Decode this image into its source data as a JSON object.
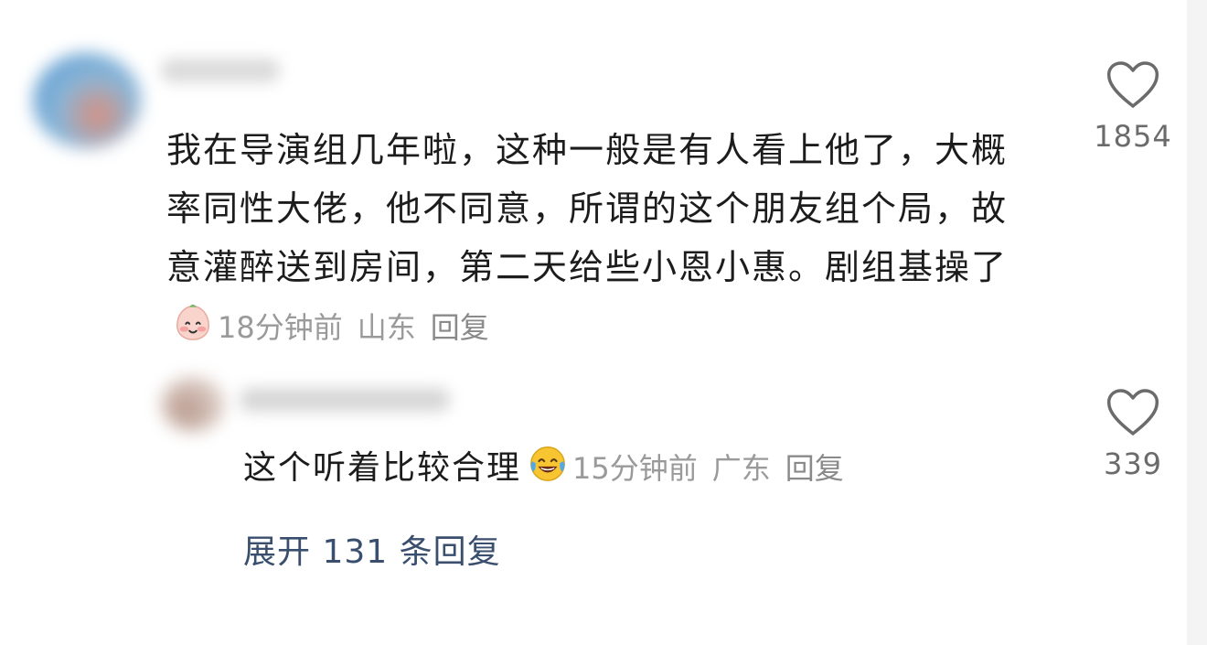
{
  "comment": {
    "text": "我在导演组几年啦，这种一般是有人看上他了，大概率同性大佬，他不同意，所谓的这个朋友组个局，故意灌醉送到房间，第二天给些小恩小惠。剧组基操了",
    "emoji": "blushing-face-emoji",
    "time": "18分钟前",
    "location": "山东",
    "reply_label": "回复",
    "likes": "1854"
  },
  "reply": {
    "text": "这个听着比较合理",
    "emoji": "laughing-tears-emoji",
    "time": "15分钟前",
    "location": "广东",
    "reply_label": "回复",
    "likes": "339"
  },
  "expand_label": "展开 131 条回复",
  "colors": {
    "text": "#1c1c1c",
    "meta": "#9a9a9a",
    "expand": "#3a4e6e",
    "heart": "#6b6b6b"
  }
}
